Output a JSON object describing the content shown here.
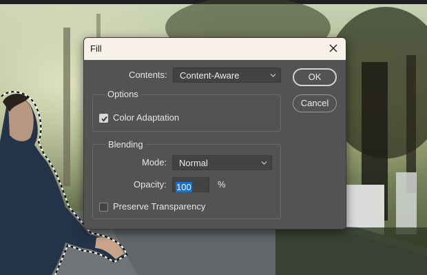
{
  "dialog": {
    "title": "Fill",
    "contents_label": "Contents:",
    "contents_value": "Content-Aware",
    "ok_label": "OK",
    "cancel_label": "Cancel",
    "options": {
      "title": "Options",
      "color_adaptation_label": "Color Adaptation",
      "color_adaptation_checked": true
    },
    "blending": {
      "title": "Blending",
      "mode_label": "Mode:",
      "mode_value": "Normal",
      "opacity_label": "Opacity:",
      "opacity_value": "100",
      "opacity_unit": "%",
      "preserve_transparency_label": "Preserve Transparency",
      "preserve_transparency_checked": false
    }
  },
  "colors": {
    "dialog_bg": "#535353",
    "titlebar_bg": "#f7f1ea",
    "selection_highlight": "#1a6fd1"
  }
}
